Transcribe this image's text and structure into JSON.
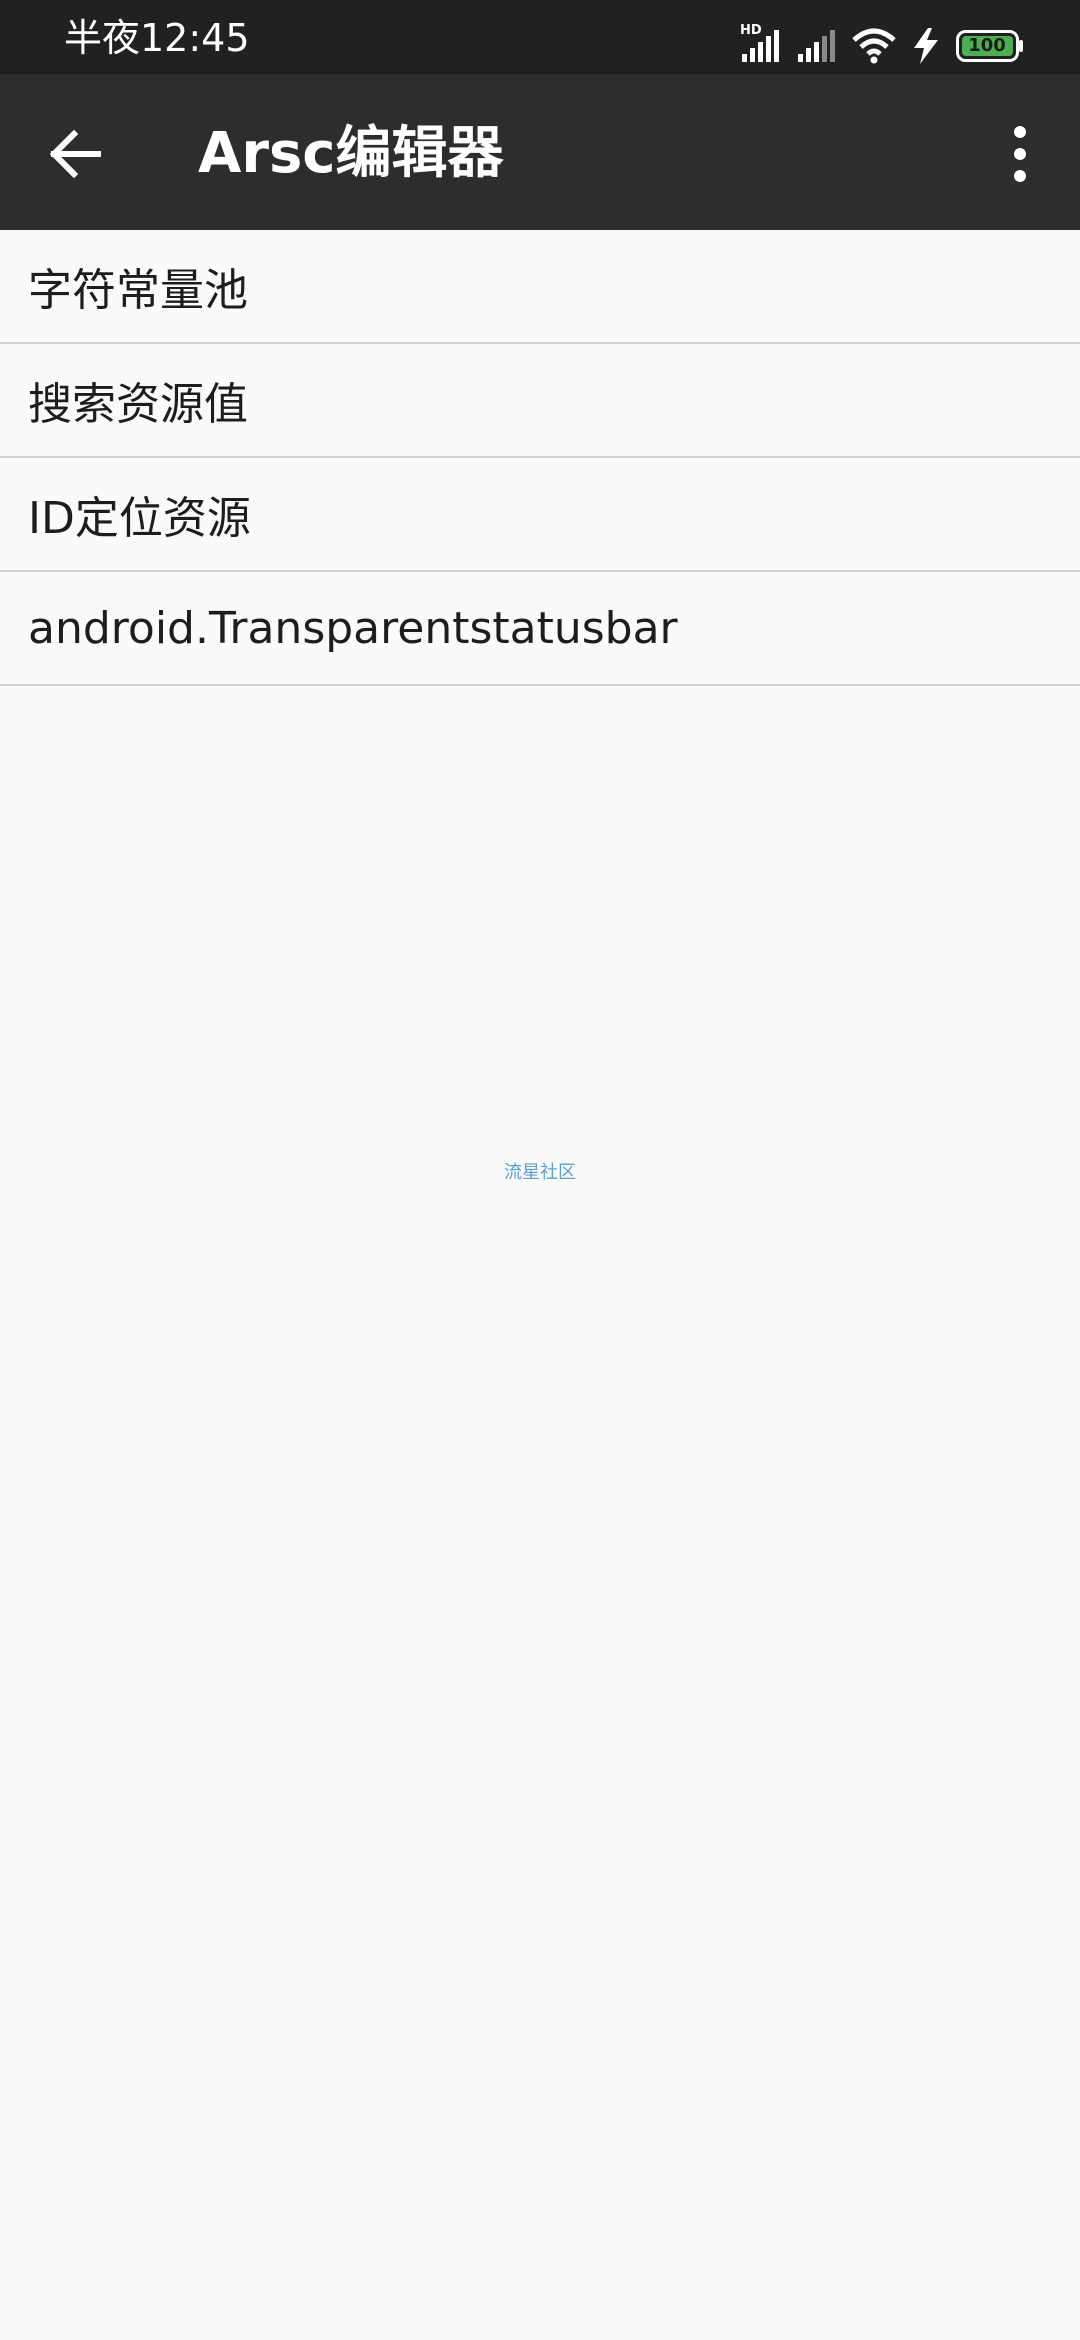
{
  "status_bar": {
    "time": "半夜12:45",
    "network_badge": "HD",
    "battery_level": "100",
    "icons": [
      "signal-hd-icon",
      "signal-icon",
      "wifi-icon",
      "charging-bolt-icon",
      "battery-icon"
    ]
  },
  "app_bar": {
    "title": "Arsc编辑器",
    "back_icon": "arrow-left-icon",
    "menu_icon": "more-vertical-icon"
  },
  "menu": {
    "items": [
      {
        "label": "字符常量池"
      },
      {
        "label": "搜索资源值"
      },
      {
        "label": "ID定位资源"
      },
      {
        "label": "android.Transparentstatusbar"
      }
    ]
  },
  "watermark": "流星社区",
  "colors": {
    "status_bar_bg": "#212121",
    "app_bar_bg": "#2d2d2d",
    "page_bg": "#fafafa",
    "battery_fill": "#4caf50",
    "watermark": "#5aa0d8"
  }
}
